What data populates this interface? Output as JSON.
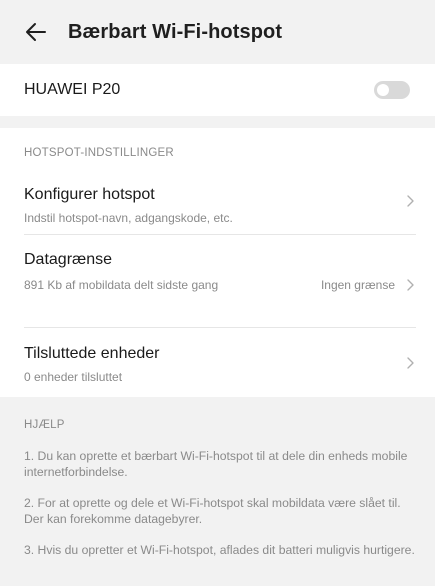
{
  "header": {
    "title": "Bærbart Wi-Fi-hotspot",
    "back_icon": "back-arrow-icon"
  },
  "device": {
    "name": "HUAWEI P20",
    "hotspot_enabled": false
  },
  "settings": {
    "section_title": "HOTSPOT-INDSTILLINGER",
    "items": [
      {
        "title": "Konfigurer hotspot",
        "subtitle": "Indstil hotspot-navn, adgangskode, etc.",
        "value": ""
      },
      {
        "title": "Datagrænse",
        "subtitle": "891 Kb af mobildata delt sidste gang",
        "value": "Ingen grænse"
      },
      {
        "title": "Tilsluttede enheder",
        "subtitle": "0 enheder tilsluttet",
        "value": ""
      }
    ]
  },
  "help": {
    "section_title": "HJÆLP",
    "items": [
      "1. Du kan oprette et bærbart Wi-Fi-hotspot til at dele din enheds mobile internetforbindelse.",
      "2. For at oprette og dele et Wi-Fi-hotspot skal mobildata være slået til. Der kan forekomme datagebyrer.",
      "3. Hvis du opretter et Wi-Fi-hotspot, aflades dit batteri muligvis hurtigere."
    ]
  },
  "colors": {
    "background": "#f2f2f2",
    "card": "#ffffff",
    "secondary_text": "#8a8a8a",
    "toggle_off": "#d9d9d9"
  }
}
